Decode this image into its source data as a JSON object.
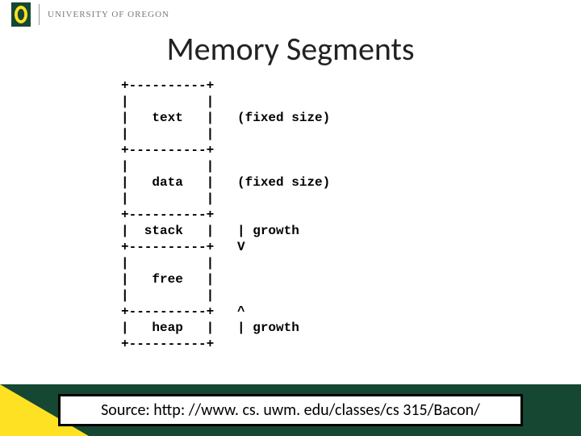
{
  "header": {
    "university": "UNIVERSITY OF OREGON"
  },
  "title": "Memory Segments",
  "diagram": {
    "raw": "+----------+\n|          |\n|   text   |   (fixed size)\n|          |\n+----------+\n|          |\n|   data   |   (fixed size)\n|          |\n+----------+\n|  stack   |   | growth\n+----------+   V\n|          |\n|   free   |\n|          |\n+----------+   ^\n|   heap   |   | growth\n+----------+",
    "segments": [
      {
        "name": "text",
        "note": "(fixed size)"
      },
      {
        "name": "data",
        "note": "(fixed size)"
      },
      {
        "name": "stack",
        "note": "growth",
        "direction": "down"
      },
      {
        "name": "free",
        "note": ""
      },
      {
        "name": "heap",
        "note": "growth",
        "direction": "up"
      }
    ]
  },
  "source": {
    "label": "Source: http: //www. cs. uwm. edu/classes/cs 315/Bacon/"
  },
  "colors": {
    "brand_green": "#154733",
    "brand_yellow": "#FEE123"
  }
}
